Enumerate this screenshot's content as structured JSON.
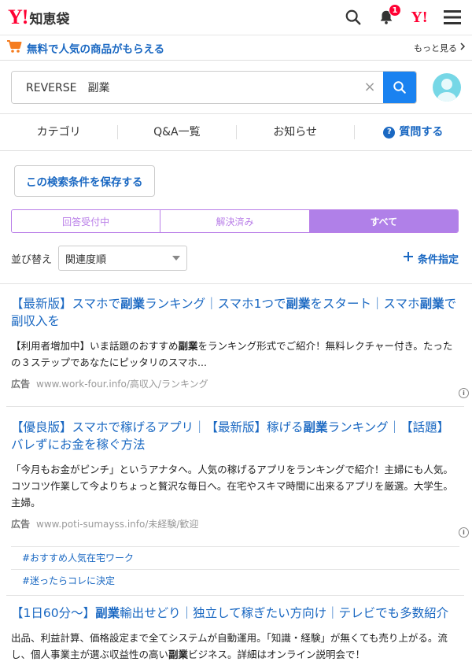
{
  "header": {
    "logo_mark": "Y!",
    "logo_text": "知恵袋",
    "notification_count": "1",
    "yj_mark": "Y!"
  },
  "promo": {
    "text": "無料で人気の商品がもらえる",
    "more": "もっと見る"
  },
  "search": {
    "value": "REVERSE　副業",
    "clear": "×"
  },
  "nav": {
    "items": [
      "カテゴリ",
      "Q&A一覧",
      "お知らせ"
    ],
    "ask": "質問する",
    "ask_icon": "?"
  },
  "save_button": "この検索条件を保存する",
  "filter_tabs": [
    "回答受付中",
    "解決済み",
    "すべて"
  ],
  "sort": {
    "label": "並び替え",
    "selected": "関連度順",
    "condition": "条件指定"
  },
  "ads": [
    {
      "title_html": "【最新版】スマホで<b>副業</b>ランキング｜スマホ1つで<b>副業</b>をスタート｜スマホ<b>副業</b>で副収入を",
      "desc_html": "【利用者増加中】いま話題のおすすめ<b>副業</b>をランキング形式でご紹介！無料レクチャー付き。たったの３ステップであなたにピッタリのスマホ...",
      "label": "広告",
      "url": "www.work-four.info/高収入/ランキング"
    },
    {
      "title_html": "【優良版】スマホで稼げるアプリ｜【最新版】稼げる<b>副業</b>ランキング｜【話題】バレずにお金を稼ぐ方法",
      "desc_html": "「今月もお金がピンチ」というアナタへ。人気の稼げるアプリをランキングで紹介！主婦にも人気。コツコツ作業して今よりちょっと贅沢な毎日へ。在宅やスキマ時間に出来るアプリを厳選。大学生。主婦。",
      "label": "広告",
      "url": "www.poti-sumayss.info/未経験/歓迎"
    },
    {
      "title_html": "【1日60分〜】<b>副業</b>輸出せどり｜独立して稼ぎたい方向け｜テレビでも多数紹介",
      "desc_html": "出品、利益計算、価格設定まで全てシステムが自動運用。「知識・経験」が無くても売り上がる。流し、個人事業主が選ぶ収益性の高い<b>副業</b>ビジネス。詳細はオンライン説明会で！",
      "label": "",
      "url": ""
    }
  ],
  "tags": [
    "#おすすめ人気在宅ワーク",
    "#迷ったらコレに決定"
  ],
  "colors": {
    "link": "#1a68c2",
    "accent_purple": "#b080e8",
    "search_button": "#1a82f0",
    "brand_red": "#ff0033"
  }
}
